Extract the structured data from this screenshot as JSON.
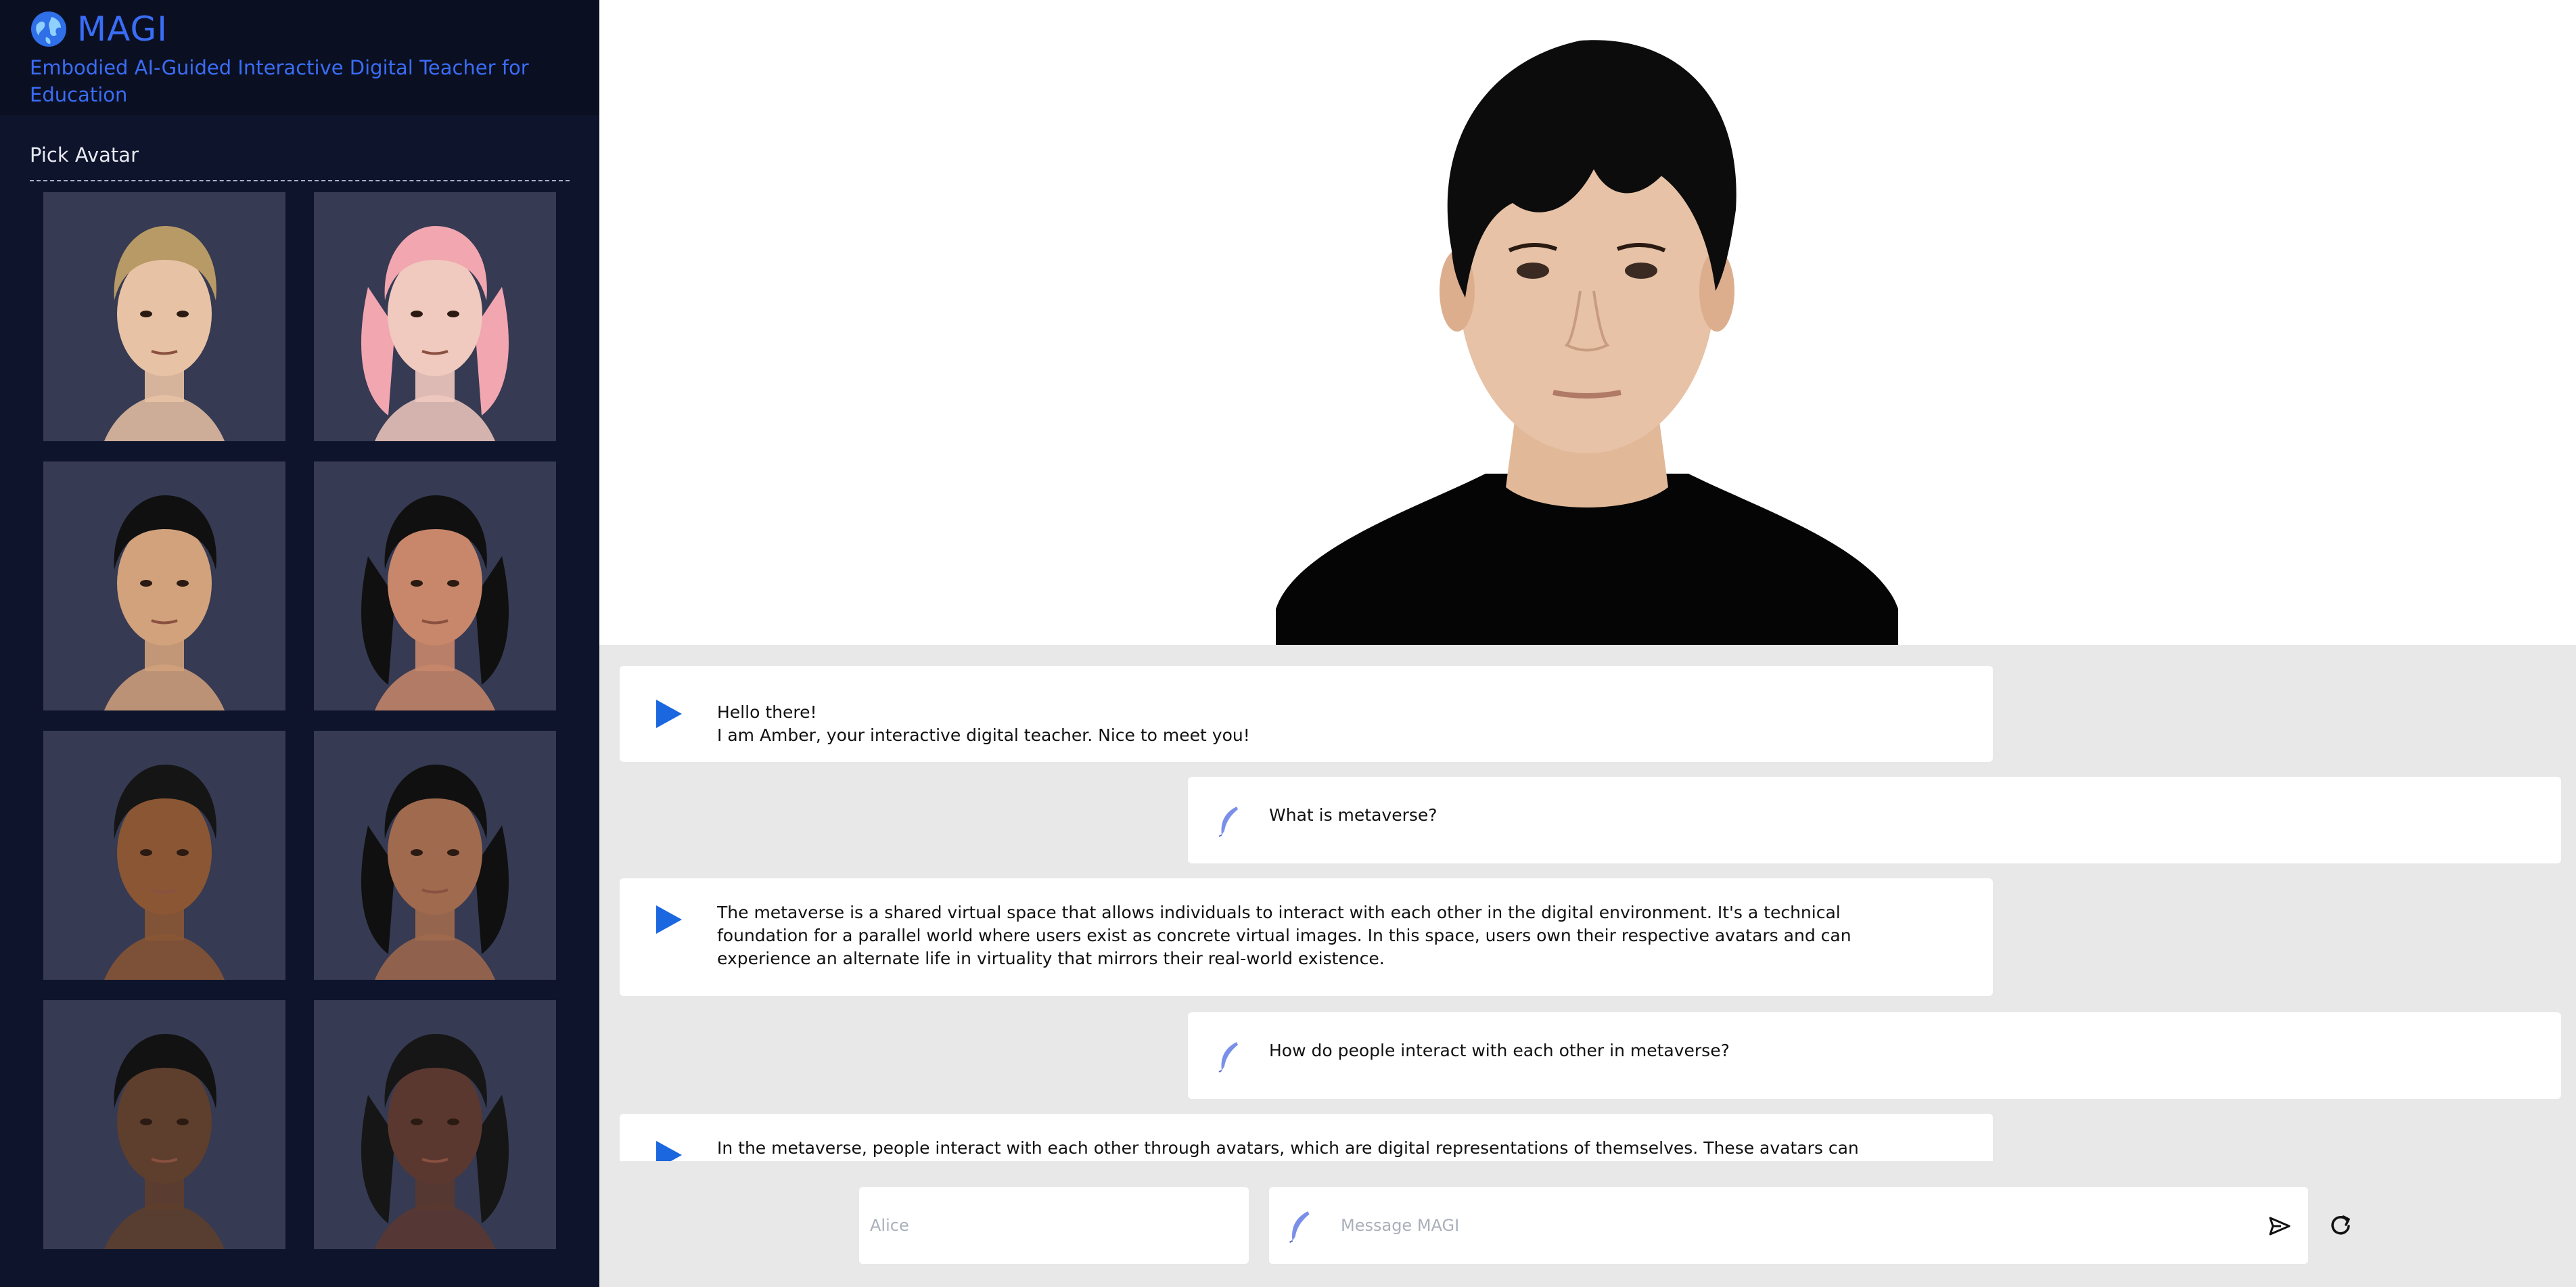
{
  "app": {
    "name": "MAGI",
    "subtitle": "Embodied AI-Guided Interactive Digital Teacher for Education",
    "logo_icon": "globe-icon"
  },
  "sidebar": {
    "pick_label": "Pick Avatar",
    "avatars": [
      {
        "hair": "#b89a66",
        "skin": "#e8c2a4",
        "long_hair": false
      },
      {
        "hair": "#f1a6b0",
        "skin": "#f0c9bf",
        "long_hair": true
      },
      {
        "hair": "#101010",
        "skin": "#d2a27c",
        "long_hair": false
      },
      {
        "hair": "#101010",
        "skin": "#c8876a",
        "long_hair": true
      },
      {
        "hair": "#151515",
        "skin": "#8a5634",
        "long_hair": false
      },
      {
        "hair": "#101010",
        "skin": "#a06a4e",
        "long_hair": true
      },
      {
        "hair": "#121212",
        "skin": "#5e3e2c",
        "long_hair": false
      },
      {
        "hair": "#161616",
        "skin": "#5a3830",
        "long_hair": true
      }
    ]
  },
  "stage": {
    "hair": "#0c0c0c",
    "skin": "#e7c2a6",
    "shirt": "#050505"
  },
  "chat": {
    "messages": [
      {
        "role": "bot",
        "text": "Hello there!\nI am Amber, your interactive digital teacher. Nice to meet you!"
      },
      {
        "role": "user",
        "text": "What is metaverse?"
      },
      {
        "role": "bot",
        "text": "The metaverse is a shared virtual space that allows individuals to interact with each other in the digital environment. It's a technical foundation for a parallel world where users exist as concrete virtual images. In this space, users own their respective avatars and can experience an alternate life in virtuality that mirrors their real-world existence."
      },
      {
        "role": "user",
        "text": "How do people interact with each other in metaverse?"
      },
      {
        "role": "bot",
        "text": "In the metaverse, people interact with each other through avatars, which are digital representations of themselves. These avatars can appear physically at a user's"
      }
    ]
  },
  "input": {
    "name_placeholder": "Alice",
    "message_placeholder": "Message MAGI",
    "send_icon": "send-icon",
    "refresh_icon": "refresh-icon"
  },
  "colors": {
    "accent": "#3a6df5",
    "sidebar_bg": "#0e142b",
    "play": "#1b67e0",
    "chat_bg": "#e8e8e8"
  }
}
